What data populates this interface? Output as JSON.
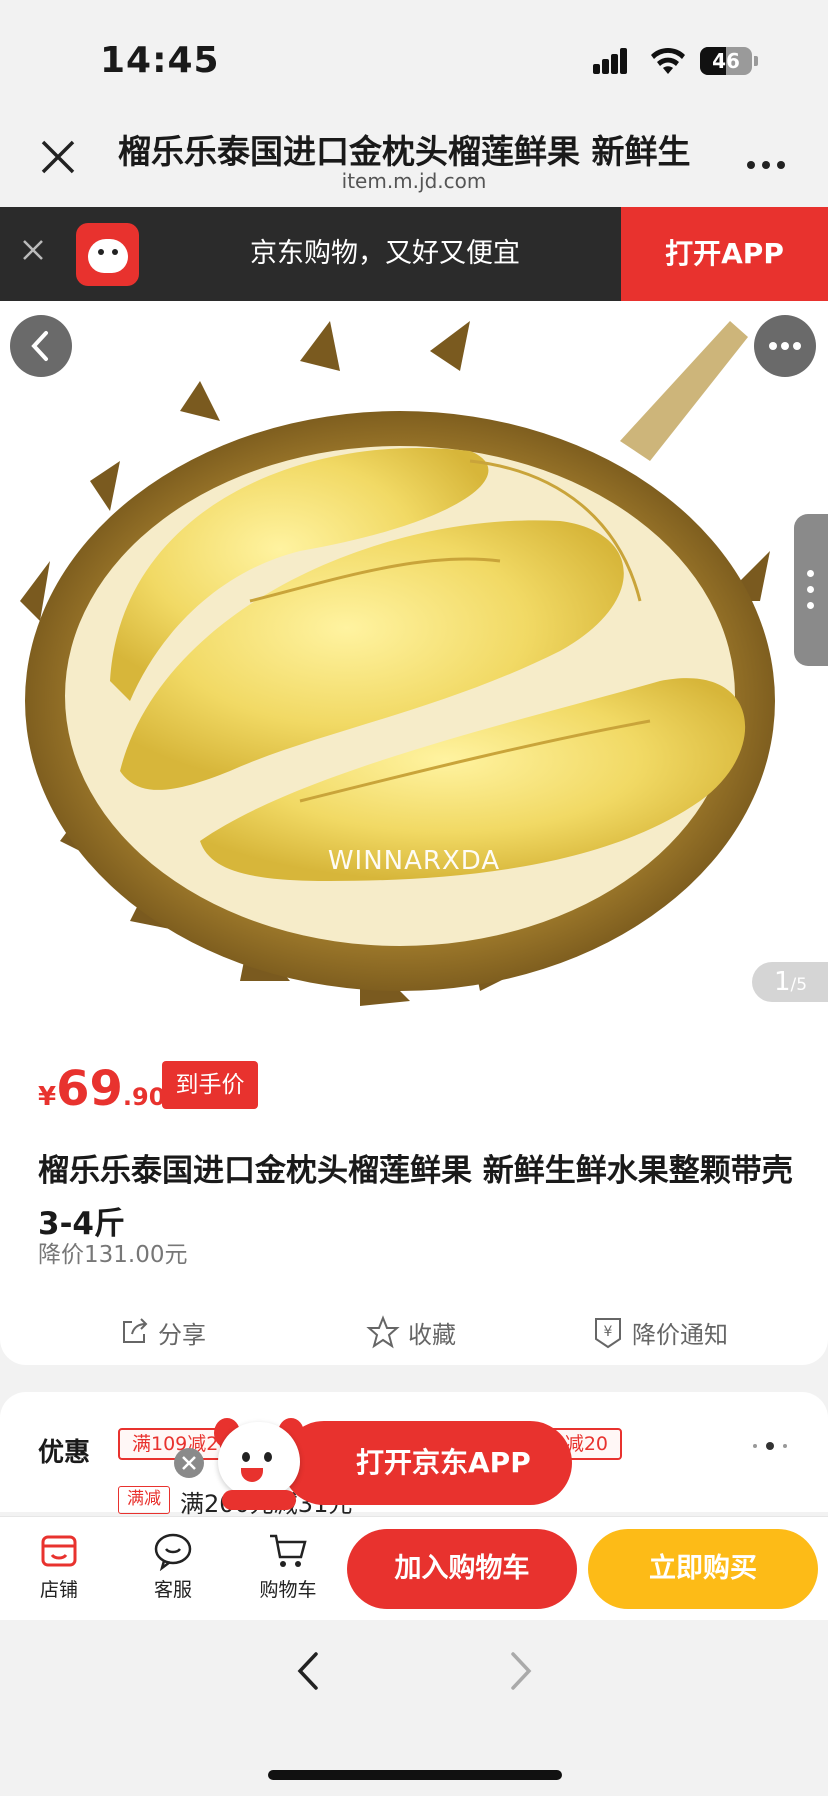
{
  "status_bar": {
    "time": "14:45",
    "battery": "46"
  },
  "browser": {
    "title": "榴乐乐泰国进口金枕头榴莲鲜果 新鲜生",
    "url": "item.m.jd.com",
    "close_icon": "close-icon",
    "more_icon": "more-icon"
  },
  "app_banner": {
    "slogan": "京东购物，又好又便宜",
    "open_label": "打开APP",
    "brand_color": "#e8322e"
  },
  "gallery": {
    "watermark": "WINNARXDA",
    "current": "1",
    "total": "/5"
  },
  "product": {
    "price_symbol": "¥",
    "price_int": "69",
    "price_dec": ".90",
    "price_tag": "到手价",
    "title": "榴乐乐泰国进口金枕头榴莲鲜果 新鲜生鲜水果整颗带壳 3-4斤",
    "price_drop": "降价131.00元",
    "actions": {
      "share": "分享",
      "favorite": "收藏",
      "notify": "降价通知"
    }
  },
  "promotions": {
    "label": "优惠",
    "coupon1": "满109减20",
    "coupon2": "满",
    "coupon3": "减20",
    "badge": "满减",
    "text": "满200元减31元"
  },
  "floating": {
    "open_label": "打开京东APP"
  },
  "bottom_bar": {
    "store": "店铺",
    "service": "客服",
    "cart": "购物车",
    "add_to_cart": "加入购物车",
    "buy_now": "立即购买",
    "buy_color": "#fdbb17"
  }
}
